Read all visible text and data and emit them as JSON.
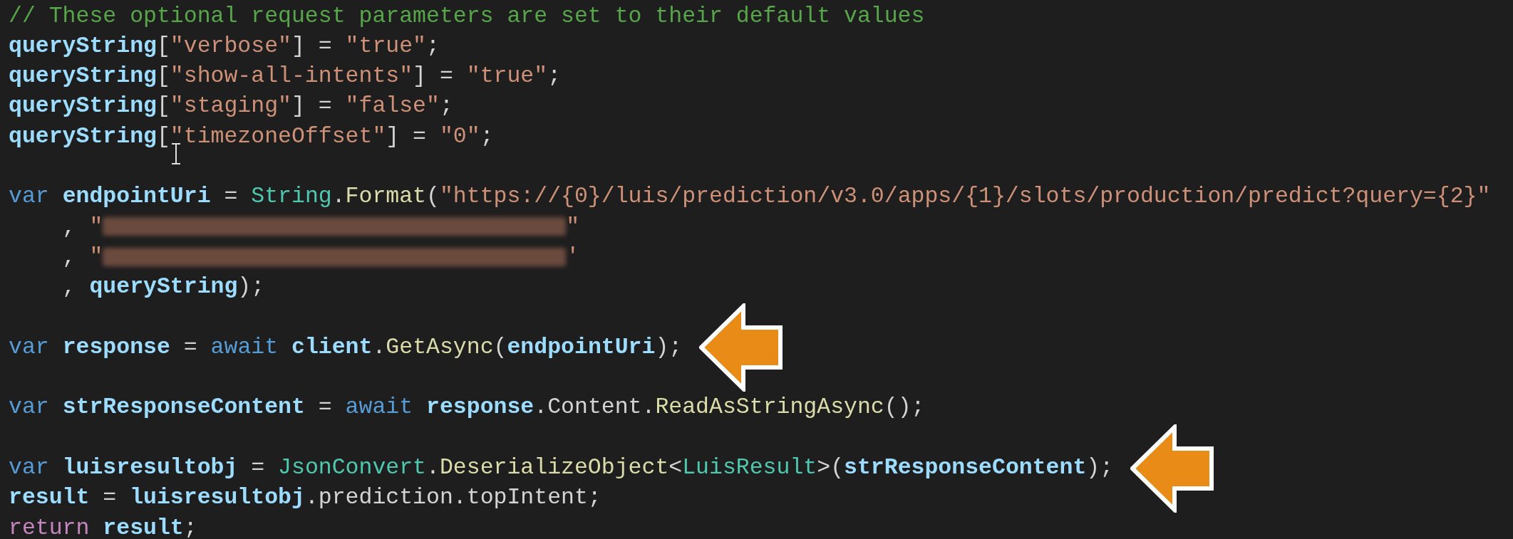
{
  "code_lines": [
    {
      "kind": "code",
      "tokens": [
        {
          "kind": "comment",
          "text": "// These optional request parameters are set to their default values"
        }
      ]
    },
    {
      "kind": "code",
      "tokens": [
        {
          "kind": "variable",
          "text": "queryString"
        },
        {
          "kind": "punct",
          "text": "["
        },
        {
          "kind": "string",
          "text": "\"verbose\""
        },
        {
          "kind": "punct",
          "text": "] = "
        },
        {
          "kind": "string",
          "text": "\"true\""
        },
        {
          "kind": "punct",
          "text": ";"
        }
      ]
    },
    {
      "kind": "code",
      "tokens": [
        {
          "kind": "variable",
          "text": "queryString"
        },
        {
          "kind": "punct",
          "text": "["
        },
        {
          "kind": "string",
          "text": "\"show-all-intents\""
        },
        {
          "kind": "punct",
          "text": "] = "
        },
        {
          "kind": "string",
          "text": "\"true\""
        },
        {
          "kind": "punct",
          "text": ";"
        }
      ]
    },
    {
      "kind": "code",
      "tokens": [
        {
          "kind": "variable",
          "text": "queryString"
        },
        {
          "kind": "punct",
          "text": "["
        },
        {
          "kind": "string",
          "text": "\"staging\""
        },
        {
          "kind": "punct",
          "text": "] = "
        },
        {
          "kind": "string",
          "text": "\"false\""
        },
        {
          "kind": "punct",
          "text": ";"
        }
      ]
    },
    {
      "kind": "code",
      "tokens": [
        {
          "kind": "variable",
          "text": "queryString"
        },
        {
          "kind": "punct",
          "text": "["
        },
        {
          "kind": "string",
          "text": "\"timezoneOffset\""
        },
        {
          "kind": "punct",
          "text": "] = "
        },
        {
          "kind": "string",
          "text": "\"0\""
        },
        {
          "kind": "punct",
          "text": ";"
        }
      ],
      "mouse_cursor": true
    },
    {
      "kind": "blank"
    },
    {
      "kind": "code",
      "tokens": [
        {
          "kind": "keyword",
          "text": "var "
        },
        {
          "kind": "variable",
          "text": "endpointUri"
        },
        {
          "kind": "punct",
          "text": " = "
        },
        {
          "kind": "type",
          "text": "String"
        },
        {
          "kind": "punct",
          "text": "."
        },
        {
          "kind": "method",
          "text": "Format"
        },
        {
          "kind": "punct",
          "text": "("
        },
        {
          "kind": "string",
          "text": "\"https://{0}/luis/prediction/v3.0/apps/{1}/slots/production/predict?query={2}\""
        }
      ]
    },
    {
      "kind": "code",
      "tokens": [
        {
          "kind": "punct",
          "text": "    , "
        },
        {
          "kind": "string",
          "text": "\""
        },
        {
          "kind": "redacted"
        },
        {
          "kind": "string",
          "text": "\""
        }
      ]
    },
    {
      "kind": "code",
      "tokens": [
        {
          "kind": "punct",
          "text": "    , "
        },
        {
          "kind": "string",
          "text": "\""
        },
        {
          "kind": "redacted"
        },
        {
          "kind": "string",
          "text": "'"
        }
      ]
    },
    {
      "kind": "code",
      "tokens": [
        {
          "kind": "punct",
          "text": "    , "
        },
        {
          "kind": "variable",
          "text": "queryString"
        },
        {
          "kind": "punct",
          "text": ");"
        }
      ]
    },
    {
      "kind": "blank"
    },
    {
      "kind": "code",
      "tokens": [
        {
          "kind": "keyword",
          "text": "var "
        },
        {
          "kind": "variable",
          "text": "response"
        },
        {
          "kind": "punct",
          "text": " = "
        },
        {
          "kind": "keyword",
          "text": "await "
        },
        {
          "kind": "variable",
          "text": "client"
        },
        {
          "kind": "punct",
          "text": "."
        },
        {
          "kind": "method",
          "text": "GetAsync"
        },
        {
          "kind": "punct",
          "text": "("
        },
        {
          "kind": "variable",
          "text": "endpointUri"
        },
        {
          "kind": "punct",
          "text": ");"
        }
      ],
      "arrow": true
    },
    {
      "kind": "blank"
    },
    {
      "kind": "code",
      "tokens": [
        {
          "kind": "keyword",
          "text": "var "
        },
        {
          "kind": "variable",
          "text": "strResponseContent"
        },
        {
          "kind": "punct",
          "text": " = "
        },
        {
          "kind": "keyword",
          "text": "await "
        },
        {
          "kind": "variable",
          "text": "response"
        },
        {
          "kind": "punct",
          "text": ".Content."
        },
        {
          "kind": "method",
          "text": "ReadAsStringAsync"
        },
        {
          "kind": "punct",
          "text": "();"
        }
      ]
    },
    {
      "kind": "blank"
    },
    {
      "kind": "code",
      "tokens": [
        {
          "kind": "keyword",
          "text": "var "
        },
        {
          "kind": "variable",
          "text": "luisresultobj"
        },
        {
          "kind": "punct",
          "text": " = "
        },
        {
          "kind": "type",
          "text": "JsonConvert"
        },
        {
          "kind": "punct",
          "text": "."
        },
        {
          "kind": "method",
          "text": "DeserializeObject"
        },
        {
          "kind": "punct",
          "text": "<"
        },
        {
          "kind": "type",
          "text": "LuisResult"
        },
        {
          "kind": "punct",
          "text": ">("
        },
        {
          "kind": "variable",
          "text": "strResponseContent"
        },
        {
          "kind": "punct",
          "text": ");"
        }
      ],
      "arrow": true
    },
    {
      "kind": "code",
      "tokens": [
        {
          "kind": "variable",
          "text": "result"
        },
        {
          "kind": "punct",
          "text": " = "
        },
        {
          "kind": "variable",
          "text": "luisresultobj"
        },
        {
          "kind": "punct",
          "text": ".prediction.topIntent;"
        }
      ]
    },
    {
      "kind": "code",
      "tokens": [
        {
          "kind": "control",
          "text": "return "
        },
        {
          "kind": "variable",
          "text": "result"
        },
        {
          "kind": "punct",
          "text": ";"
        }
      ]
    }
  ]
}
